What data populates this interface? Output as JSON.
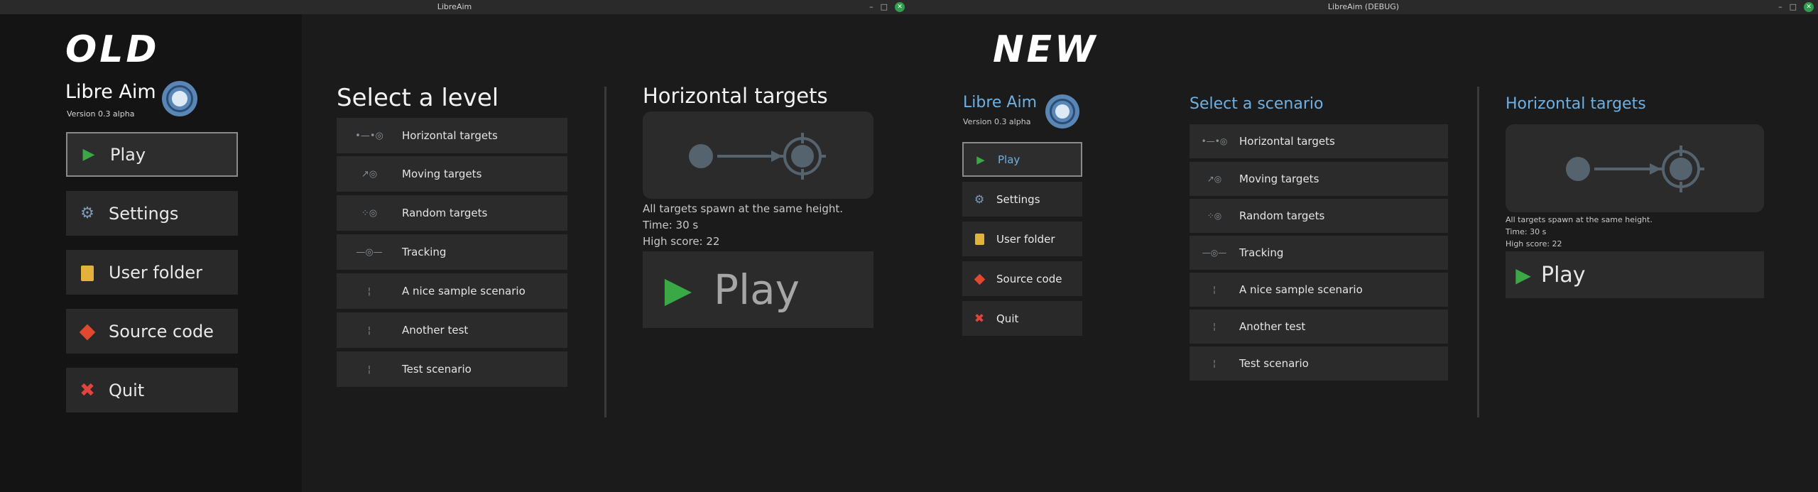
{
  "old": {
    "window_title": "LibreAim",
    "label": "OLD",
    "app_title": "Libre Aim",
    "version": "Version 0.3 alpha",
    "menu": [
      {
        "label": "Play",
        "icon": "play-icon"
      },
      {
        "label": "Settings",
        "icon": "gear-icon"
      },
      {
        "label": "User folder",
        "icon": "folder-icon"
      },
      {
        "label": "Source code",
        "icon": "git-icon"
      },
      {
        "label": "Quit",
        "icon": "close-icon"
      }
    ],
    "list_heading": "Select a level",
    "levels": [
      {
        "label": "Horizontal targets"
      },
      {
        "label": "Moving targets"
      },
      {
        "label": "Random targets"
      },
      {
        "label": "Tracking"
      },
      {
        "label": "A nice sample scenario"
      },
      {
        "label": "Another test"
      },
      {
        "label": "Test scenario"
      }
    ],
    "detail_title": "Horizontal targets",
    "description": "All targets spawn at the same height.",
    "time": "Time: 30 s",
    "high_score": "High score: 22",
    "play_label": "Play"
  },
  "new": {
    "window_title": "LibreAim (DEBUG)",
    "label": "NEW",
    "app_title": "Libre Aim",
    "version": "Version 0.3 alpha",
    "menu": [
      {
        "label": "Play",
        "icon": "play-icon"
      },
      {
        "label": "Settings",
        "icon": "gear-icon"
      },
      {
        "label": "User folder",
        "icon": "folder-icon"
      },
      {
        "label": "Source code",
        "icon": "git-icon"
      },
      {
        "label": "Quit",
        "icon": "close-icon"
      }
    ],
    "list_heading": "Select a scenario",
    "levels": [
      {
        "label": "Horizontal targets"
      },
      {
        "label": "Moving targets"
      },
      {
        "label": "Random targets"
      },
      {
        "label": "Tracking"
      },
      {
        "label": "A nice sample scenario"
      },
      {
        "label": "Another test"
      },
      {
        "label": "Test scenario"
      }
    ],
    "detail_title": "Horizontal targets",
    "description": "All targets spawn at the same height.",
    "time": "Time: 30 s",
    "high_score": "High score: 22",
    "play_label": "Play"
  },
  "colors": {
    "accent_new": "#6fb0e3",
    "play_green": "#3aa845",
    "folder_yellow": "#e3b23c",
    "git_red": "#e0492f",
    "quit_red": "#e0443a",
    "gear_blue": "#7d9bb8"
  }
}
